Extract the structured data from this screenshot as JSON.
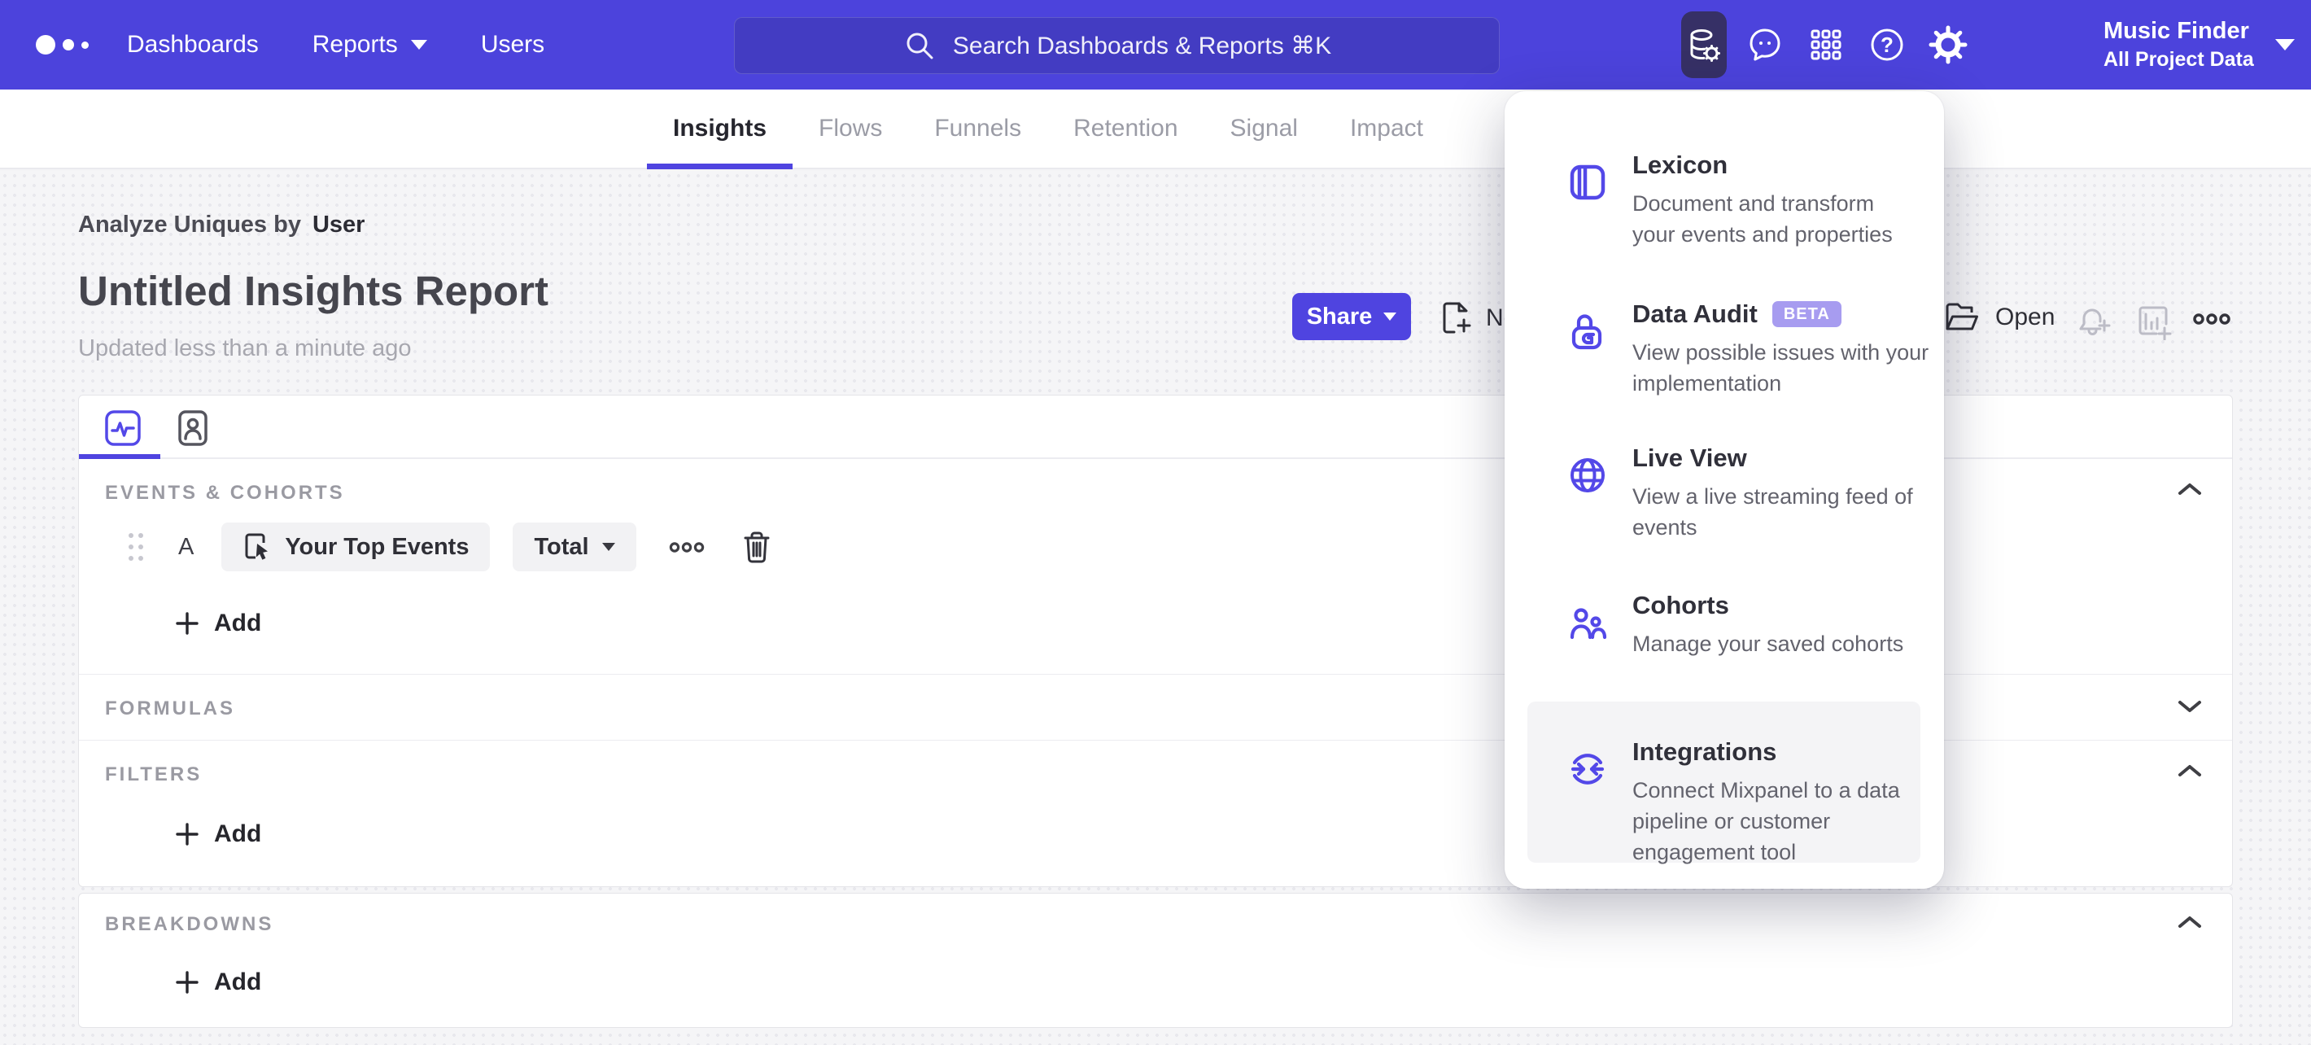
{
  "topbar": {
    "nav": [
      {
        "label": "Dashboards"
      },
      {
        "label": "Reports"
      },
      {
        "label": "Users"
      }
    ],
    "search": {
      "placeholder": "Search Dashboards & Reports ⌘K"
    },
    "project": {
      "name": "Music Finder",
      "scope": "All Project Data"
    }
  },
  "tabs": [
    {
      "label": "Insights"
    },
    {
      "label": "Flows"
    },
    {
      "label": "Funnels"
    },
    {
      "label": "Retention"
    },
    {
      "label": "Signal"
    },
    {
      "label": "Impact"
    }
  ],
  "report": {
    "context_prefix": "Analyze Uniques by",
    "context_value": "User",
    "title": "Untitled Insights Report",
    "updated": "Updated less than a minute ago"
  },
  "actions": {
    "share": "Share",
    "new": "New",
    "open": "Open"
  },
  "builder": {
    "events_header": "EVENTS & COHORTS",
    "formulas_header": "FORMULAS",
    "filters_header": "FILTERS",
    "breakdowns_header": "BREAKDOWNS",
    "row": {
      "letter": "A",
      "event": "Your Top Events",
      "metric": "Total"
    },
    "add_label": "Add"
  },
  "menu": {
    "items": [
      {
        "title": "Lexicon",
        "desc": "Document and transform\nyour events and properties"
      },
      {
        "title": "Data Audit",
        "badge": "BETA",
        "desc": "View possible issues with your\nimplementation"
      },
      {
        "title": "Live View",
        "desc": "View a live streaming feed of\nevents"
      },
      {
        "title": "Cohorts",
        "desc": "Manage your saved cohorts"
      },
      {
        "title": "Integrations",
        "desc": "Connect Mixpanel to a data\npipeline or customer\nengagement tool"
      }
    ]
  },
  "colors": {
    "accent": "#4f44e0",
    "topbar": "#4c43dc",
    "beta_badge": "#a79cf0"
  }
}
